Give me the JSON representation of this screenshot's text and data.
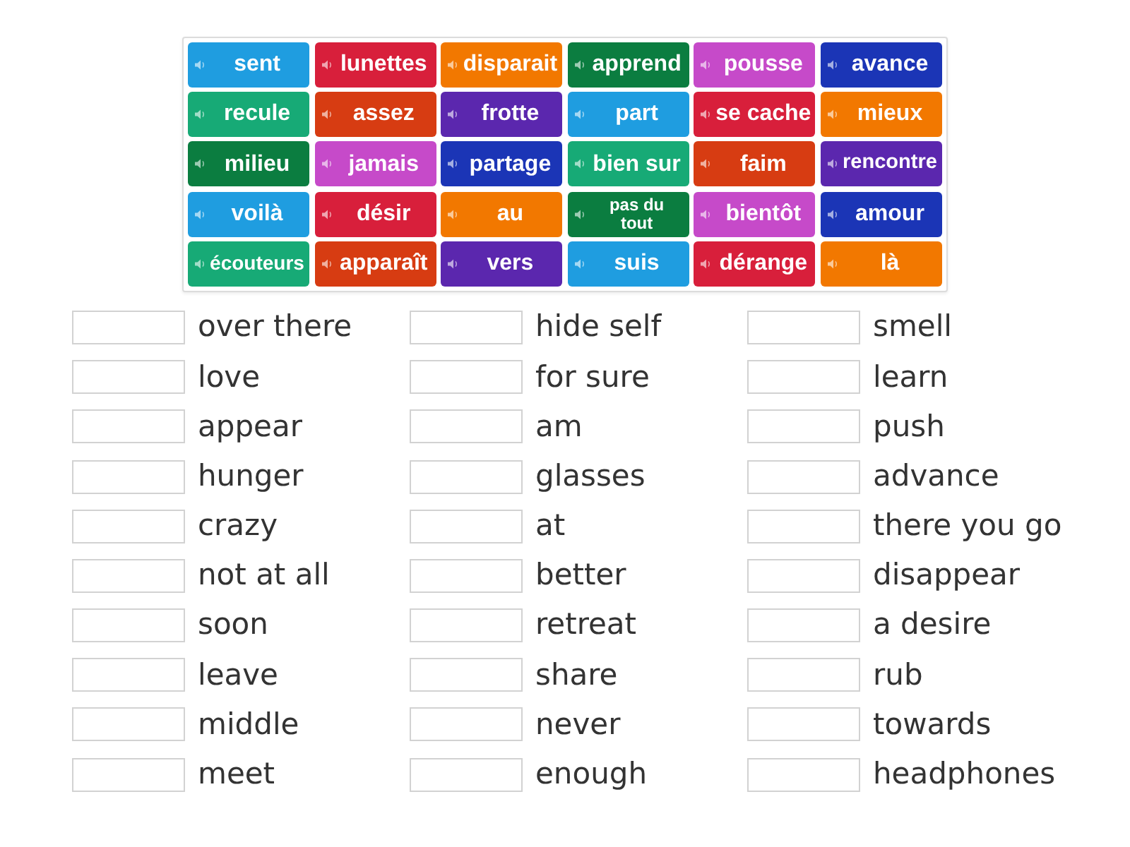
{
  "tiles": [
    {
      "text": "sent",
      "color": "#1f9de0"
    },
    {
      "text": "lunettes",
      "color": "#d81f3b"
    },
    {
      "text": "disparait",
      "color": "#f27800"
    },
    {
      "text": "apprend",
      "color": "#0b7d40"
    },
    {
      "text": "pousse",
      "color": "#c64ac9"
    },
    {
      "text": "avance",
      "color": "#1b35b6"
    },
    {
      "text": "recule",
      "color": "#17aa76"
    },
    {
      "text": "assez",
      "color": "#d73c12"
    },
    {
      "text": "frotte",
      "color": "#5b27ae"
    },
    {
      "text": "part",
      "color": "#1f9de0"
    },
    {
      "text": "se cache",
      "color": "#d81f3b"
    },
    {
      "text": "mieux",
      "color": "#f27800"
    },
    {
      "text": "milieu",
      "color": "#0b7d40"
    },
    {
      "text": "jamais",
      "color": "#c64ac9"
    },
    {
      "text": "partage",
      "color": "#1b35b6"
    },
    {
      "text": "bien sur",
      "color": "#17aa76"
    },
    {
      "text": "faim",
      "color": "#d73c12"
    },
    {
      "text": "rencontre",
      "color": "#5b27ae"
    },
    {
      "text": "voilà",
      "color": "#1f9de0"
    },
    {
      "text": "désir",
      "color": "#d81f3b"
    },
    {
      "text": "au",
      "color": "#f27800"
    },
    {
      "text": "pas du tout",
      "color": "#0b7d40"
    },
    {
      "text": "bientôt",
      "color": "#c64ac9"
    },
    {
      "text": "amour",
      "color": "#1b35b6"
    },
    {
      "text": "écouteurs",
      "color": "#17aa76"
    },
    {
      "text": "apparaît",
      "color": "#d73c12"
    },
    {
      "text": "vers",
      "color": "#5b27ae"
    },
    {
      "text": "suis",
      "color": "#1f9de0"
    },
    {
      "text": "dérange",
      "color": "#d81f3b"
    },
    {
      "text": "là",
      "color": "#f27800"
    }
  ],
  "answer_columns": [
    [
      "over there",
      "love",
      "appear",
      "hunger",
      "crazy",
      "not at all",
      "soon",
      "leave",
      "middle",
      "meet"
    ],
    [
      "hide self",
      "for sure",
      "am",
      "glasses",
      "at",
      "better",
      "retreat",
      "share",
      "never",
      "enough"
    ],
    [
      "smell",
      "learn",
      "push",
      "advance",
      "there you go",
      "disappear",
      "a desire",
      "rub",
      "towards",
      "headphones"
    ]
  ]
}
